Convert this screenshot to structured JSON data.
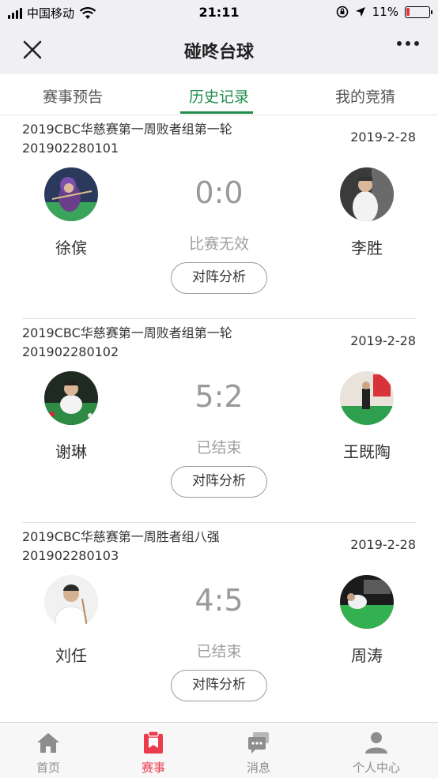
{
  "status_bar": {
    "carrier": "中国移动",
    "time": "21:11",
    "battery": "11%"
  },
  "nav": {
    "title": "碰咚台球"
  },
  "tabs": [
    {
      "label": "赛事预告",
      "active": false
    },
    {
      "label": "历史记录",
      "active": true
    },
    {
      "label": "我的竞猜",
      "active": false
    }
  ],
  "matches": [
    {
      "title": "2019CBC华慈赛第一周败者组第一轮",
      "code": "201902280101",
      "date": "2019-2-28",
      "player1": "徐傧",
      "player2": "李胜",
      "score": "0:0",
      "status": "比赛无效",
      "button": "对阵分析"
    },
    {
      "title": "2019CBC华慈赛第一周败者组第一轮",
      "code": "201902280102",
      "date": "2019-2-28",
      "player1": "谢琳",
      "player2": "王既陶",
      "score": "5:2",
      "status": "已结束",
      "button": "对阵分析"
    },
    {
      "title": "2019CBC华慈赛第一周胜者组八强",
      "code": "201902280103",
      "date": "2019-2-28",
      "player1": "刘任",
      "player2": "周涛",
      "score": "4:5",
      "status": "已结束",
      "button": "对阵分析"
    }
  ],
  "tabbar": [
    {
      "label": "首页",
      "icon": "home-icon",
      "active": false
    },
    {
      "label": "赛事",
      "icon": "events-icon",
      "active": true
    },
    {
      "label": "消息",
      "icon": "message-icon",
      "active": false
    },
    {
      "label": "个人中心",
      "icon": "profile-icon",
      "active": false
    }
  ],
  "colors": {
    "accent_green": "#1f8c4a",
    "tab_active_red": "#ec3c4b",
    "score_gray": "#999999"
  }
}
